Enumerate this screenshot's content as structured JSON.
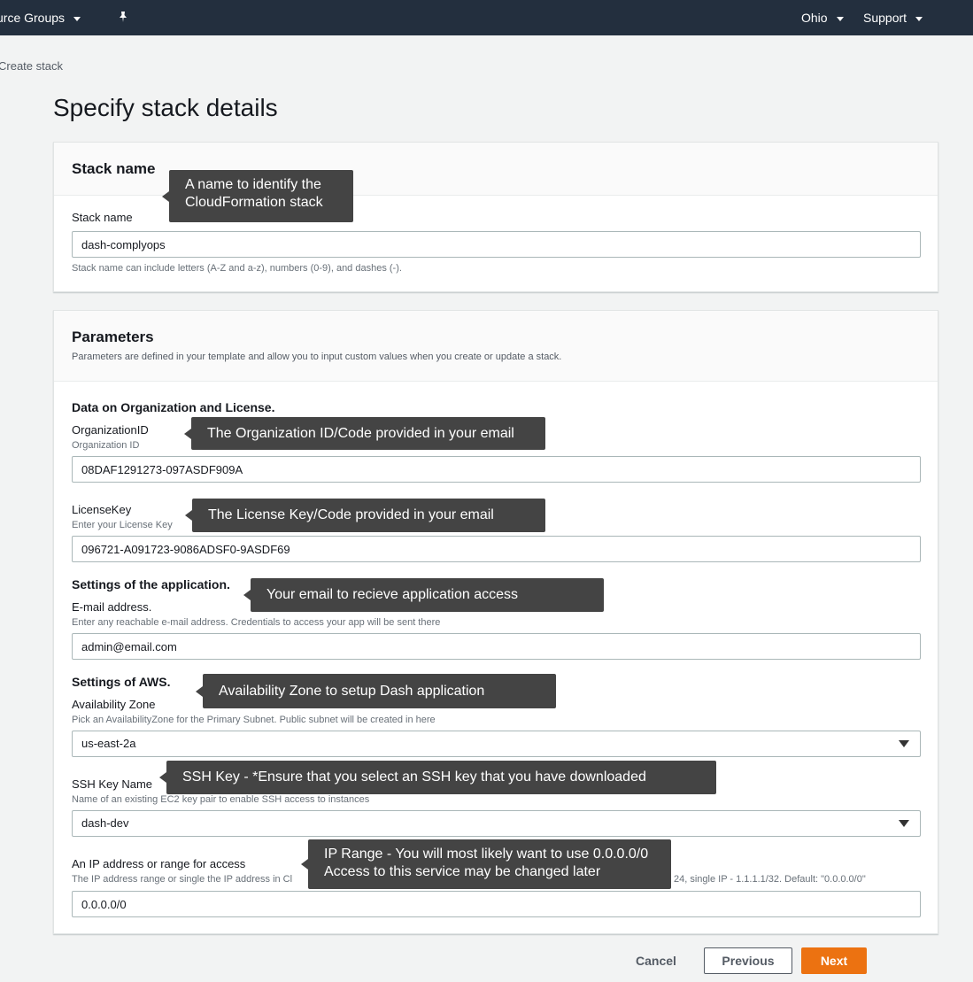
{
  "topbar": {
    "resource_groups": "urce Groups",
    "region": "Ohio",
    "support": "Support"
  },
  "breadcrumb": "Create stack",
  "page_title": "Specify stack details",
  "stack_name_panel": {
    "heading": "Stack name",
    "field_label": "Stack name",
    "value": "dash-complyops",
    "hint": "Stack name can include letters (A-Z and a-z), numbers (0-9), and dashes (-)."
  },
  "parameters_panel": {
    "heading": "Parameters",
    "description": "Parameters are defined in your template and allow you to input custom values when you create or update a stack.",
    "section_org": "Data on Organization and License.",
    "org_id": {
      "label": "OrganizationID",
      "sublabel": "Organization ID",
      "value": "08DAF1291273-097ASDF909A"
    },
    "license": {
      "label": "LicenseKey",
      "sublabel": "Enter your License Key",
      "value": "096721-A091723-9086ADSF0-9ASDF69"
    },
    "section_app": "Settings of the application.",
    "email": {
      "label": "E-mail address.",
      "sublabel": "Enter any reachable e-mail address. Credentials to access your app will be sent there",
      "value": "admin@email.com"
    },
    "section_aws": "Settings of AWS.",
    "az": {
      "label": "Availability Zone",
      "sublabel": "Pick an AvailabilityZone for the Primary Subnet. Public subnet will be created in here",
      "value": "us-east-2a"
    },
    "ssh": {
      "label": "SSH Key Name",
      "sublabel": "Name of an existing EC2 key pair to enable SSH access to instances",
      "value": "dash-dev"
    },
    "ip": {
      "label": "An IP address or range for access",
      "sublabel_left": "The IP address range or single the IP address in Cl",
      "sublabel_right": "24, single IP - 1.1.1.1/32. Default: \"0.0.0.0/0\"",
      "value": "0.0.0.0/0"
    }
  },
  "tooltips": {
    "stack_name_1": "A name to identify the",
    "stack_name_2": "CloudFormation stack",
    "org_id": "The Organization ID/Code provided in your email",
    "license": "The License Key/Code provided in your email",
    "email": "Your email to recieve application access",
    "az": "Availability Zone to setup Dash application",
    "ssh": "SSH Key - *Ensure that you select an SSH key that you have downloaded",
    "ip_1": "IP Range - You will most likely want to use 0.0.0.0/0",
    "ip_2": "Access to this service may be changed later"
  },
  "buttons": {
    "cancel": "Cancel",
    "previous": "Previous",
    "next": "Next"
  },
  "colors": {
    "topbar_bg": "#232f3e",
    "primary_button": "#ec7211",
    "tooltip_bg": "#444444"
  }
}
